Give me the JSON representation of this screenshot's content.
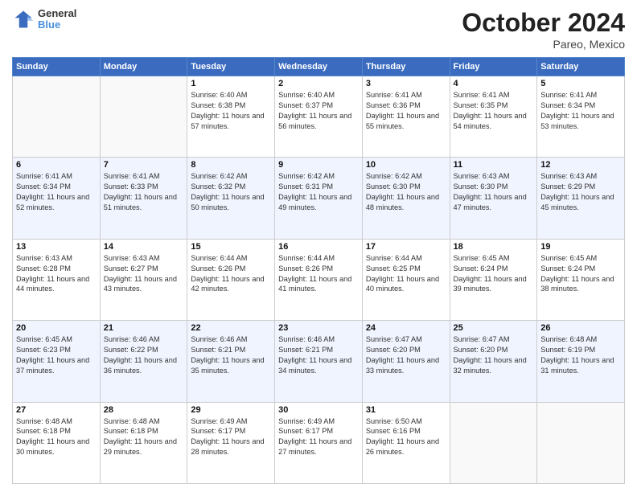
{
  "header": {
    "logo_line1": "General",
    "logo_line2": "Blue",
    "title": "October 2024",
    "subtitle": "Pareo, Mexico"
  },
  "days_of_week": [
    "Sunday",
    "Monday",
    "Tuesday",
    "Wednesday",
    "Thursday",
    "Friday",
    "Saturday"
  ],
  "weeks": [
    [
      {
        "day": "",
        "info": ""
      },
      {
        "day": "",
        "info": ""
      },
      {
        "day": "1",
        "info": "Sunrise: 6:40 AM\nSunset: 6:38 PM\nDaylight: 11 hours and 57 minutes."
      },
      {
        "day": "2",
        "info": "Sunrise: 6:40 AM\nSunset: 6:37 PM\nDaylight: 11 hours and 56 minutes."
      },
      {
        "day": "3",
        "info": "Sunrise: 6:41 AM\nSunset: 6:36 PM\nDaylight: 11 hours and 55 minutes."
      },
      {
        "day": "4",
        "info": "Sunrise: 6:41 AM\nSunset: 6:35 PM\nDaylight: 11 hours and 54 minutes."
      },
      {
        "day": "5",
        "info": "Sunrise: 6:41 AM\nSunset: 6:34 PM\nDaylight: 11 hours and 53 minutes."
      }
    ],
    [
      {
        "day": "6",
        "info": "Sunrise: 6:41 AM\nSunset: 6:34 PM\nDaylight: 11 hours and 52 minutes."
      },
      {
        "day": "7",
        "info": "Sunrise: 6:41 AM\nSunset: 6:33 PM\nDaylight: 11 hours and 51 minutes."
      },
      {
        "day": "8",
        "info": "Sunrise: 6:42 AM\nSunset: 6:32 PM\nDaylight: 11 hours and 50 minutes."
      },
      {
        "day": "9",
        "info": "Sunrise: 6:42 AM\nSunset: 6:31 PM\nDaylight: 11 hours and 49 minutes."
      },
      {
        "day": "10",
        "info": "Sunrise: 6:42 AM\nSunset: 6:30 PM\nDaylight: 11 hours and 48 minutes."
      },
      {
        "day": "11",
        "info": "Sunrise: 6:43 AM\nSunset: 6:30 PM\nDaylight: 11 hours and 47 minutes."
      },
      {
        "day": "12",
        "info": "Sunrise: 6:43 AM\nSunset: 6:29 PM\nDaylight: 11 hours and 45 minutes."
      }
    ],
    [
      {
        "day": "13",
        "info": "Sunrise: 6:43 AM\nSunset: 6:28 PM\nDaylight: 11 hours and 44 minutes."
      },
      {
        "day": "14",
        "info": "Sunrise: 6:43 AM\nSunset: 6:27 PM\nDaylight: 11 hours and 43 minutes."
      },
      {
        "day": "15",
        "info": "Sunrise: 6:44 AM\nSunset: 6:26 PM\nDaylight: 11 hours and 42 minutes."
      },
      {
        "day": "16",
        "info": "Sunrise: 6:44 AM\nSunset: 6:26 PM\nDaylight: 11 hours and 41 minutes."
      },
      {
        "day": "17",
        "info": "Sunrise: 6:44 AM\nSunset: 6:25 PM\nDaylight: 11 hours and 40 minutes."
      },
      {
        "day": "18",
        "info": "Sunrise: 6:45 AM\nSunset: 6:24 PM\nDaylight: 11 hours and 39 minutes."
      },
      {
        "day": "19",
        "info": "Sunrise: 6:45 AM\nSunset: 6:24 PM\nDaylight: 11 hours and 38 minutes."
      }
    ],
    [
      {
        "day": "20",
        "info": "Sunrise: 6:45 AM\nSunset: 6:23 PM\nDaylight: 11 hours and 37 minutes."
      },
      {
        "day": "21",
        "info": "Sunrise: 6:46 AM\nSunset: 6:22 PM\nDaylight: 11 hours and 36 minutes."
      },
      {
        "day": "22",
        "info": "Sunrise: 6:46 AM\nSunset: 6:21 PM\nDaylight: 11 hours and 35 minutes."
      },
      {
        "day": "23",
        "info": "Sunrise: 6:46 AM\nSunset: 6:21 PM\nDaylight: 11 hours and 34 minutes."
      },
      {
        "day": "24",
        "info": "Sunrise: 6:47 AM\nSunset: 6:20 PM\nDaylight: 11 hours and 33 minutes."
      },
      {
        "day": "25",
        "info": "Sunrise: 6:47 AM\nSunset: 6:20 PM\nDaylight: 11 hours and 32 minutes."
      },
      {
        "day": "26",
        "info": "Sunrise: 6:48 AM\nSunset: 6:19 PM\nDaylight: 11 hours and 31 minutes."
      }
    ],
    [
      {
        "day": "27",
        "info": "Sunrise: 6:48 AM\nSunset: 6:18 PM\nDaylight: 11 hours and 30 minutes."
      },
      {
        "day": "28",
        "info": "Sunrise: 6:48 AM\nSunset: 6:18 PM\nDaylight: 11 hours and 29 minutes."
      },
      {
        "day": "29",
        "info": "Sunrise: 6:49 AM\nSunset: 6:17 PM\nDaylight: 11 hours and 28 minutes."
      },
      {
        "day": "30",
        "info": "Sunrise: 6:49 AM\nSunset: 6:17 PM\nDaylight: 11 hours and 27 minutes."
      },
      {
        "day": "31",
        "info": "Sunrise: 6:50 AM\nSunset: 6:16 PM\nDaylight: 11 hours and 26 minutes."
      },
      {
        "day": "",
        "info": ""
      },
      {
        "day": "",
        "info": ""
      }
    ]
  ]
}
